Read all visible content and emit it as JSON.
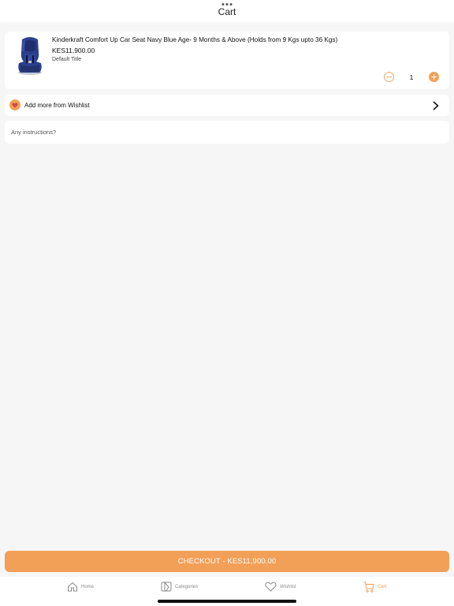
{
  "header": {
    "title": "Cart"
  },
  "cart_item": {
    "name": "Kinderkraft Comfort Up Car Seat Navy Blue Age- 9 Months & Above (Holds from 9 Kgs upto 36 Kgs)",
    "price": "KES11,900.00",
    "variant": "Default Title",
    "quantity": "1"
  },
  "wishlist_row": {
    "label": "Add more from Wishlist"
  },
  "instructions": {
    "placeholder": "Any instructions?",
    "value": ""
  },
  "checkout": {
    "label": "CHECKOUT - KES11,900.00"
  },
  "tabbar": {
    "items": [
      {
        "label": "Home",
        "icon": "home-icon"
      },
      {
        "label": "Categories",
        "icon": "categories-icon"
      },
      {
        "label": "Wishlist",
        "icon": "heart-icon"
      },
      {
        "label": "Cart",
        "icon": "cart-icon",
        "active": true
      }
    ]
  },
  "colors": {
    "accent": "#f2a057",
    "background": "#f6f6f6",
    "card": "#ffffff",
    "tab_inactive": "#8a8a8a"
  }
}
